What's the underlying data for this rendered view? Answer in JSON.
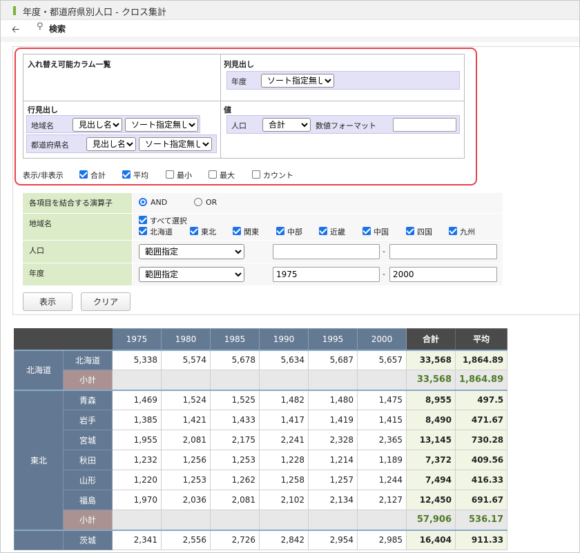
{
  "window": {
    "title": "年度・都道府県別人口 - クロス集計"
  },
  "toolbar": {
    "search_label": "検索"
  },
  "config": {
    "columns_list_title": "入れ替え可能カラム一覧",
    "col_header_title": "列見出し",
    "col_header": {
      "label": "年度",
      "sort": "ソート指定無し"
    },
    "row_header_title": "行見出し",
    "row_headers": [
      {
        "label": "地域名",
        "display": "見出し名",
        "sort": "ソート指定無し"
      },
      {
        "label": "都道府県名",
        "display": "見出し名",
        "sort": "ソート指定無し"
      }
    ],
    "value_title": "値",
    "value": {
      "label": "人口",
      "agg": "合計",
      "format_label": "数値フォーマット",
      "format_value": ""
    },
    "show_hide": {
      "label": "表示/非表示",
      "options": [
        {
          "label": "合計",
          "checked": true
        },
        {
          "label": "平均",
          "checked": true
        },
        {
          "label": "最小",
          "checked": false
        },
        {
          "label": "最大",
          "checked": false
        },
        {
          "label": "カウント",
          "checked": false
        }
      ]
    }
  },
  "conditions": {
    "operator_label": "各項目を結合する演算子",
    "operator_and": "AND",
    "operator_or": "OR",
    "region_label": "地域名",
    "select_all": "すべて選択",
    "regions": [
      "北海道",
      "東北",
      "関東",
      "中部",
      "近畿",
      "中国",
      "四国",
      "九州"
    ],
    "population_label": "人口",
    "population_mode": "範囲指定",
    "population_from": "",
    "population_to": "",
    "year_label": "年度",
    "year_mode": "範囲指定",
    "year_from": "1975",
    "year_to": "2000",
    "range_sep": "-"
  },
  "buttons": {
    "show": "表示",
    "clear": "クリア"
  },
  "grid": {
    "years": [
      "1975",
      "1980",
      "1985",
      "1990",
      "1995",
      "2000"
    ],
    "total_header": "合計",
    "avg_header": "平均",
    "subtotal_label": "小計",
    "groups": [
      {
        "region": "北海道",
        "rows": [
          {
            "pref": "北海道",
            "values": [
              "5,338",
              "5,574",
              "5,678",
              "5,634",
              "5,687",
              "5,657"
            ],
            "total": "33,568",
            "avg": "1,864.89"
          }
        ],
        "subtotal": {
          "total": "33,568",
          "avg": "1,864.89"
        }
      },
      {
        "region": "東北",
        "rows": [
          {
            "pref": "青森",
            "values": [
              "1,469",
              "1,524",
              "1,525",
              "1,482",
              "1,480",
              "1,475"
            ],
            "total": "8,955",
            "avg": "497.5"
          },
          {
            "pref": "岩手",
            "values": [
              "1,385",
              "1,421",
              "1,433",
              "1,417",
              "1,419",
              "1,415"
            ],
            "total": "8,490",
            "avg": "471.67"
          },
          {
            "pref": "宮城",
            "values": [
              "1,955",
              "2,081",
              "2,175",
              "2,241",
              "2,328",
              "2,365"
            ],
            "total": "13,145",
            "avg": "730.28"
          },
          {
            "pref": "秋田",
            "values": [
              "1,232",
              "1,256",
              "1,253",
              "1,228",
              "1,214",
              "1,189"
            ],
            "total": "7,372",
            "avg": "409.56"
          },
          {
            "pref": "山形",
            "values": [
              "1,220",
              "1,253",
              "1,262",
              "1,258",
              "1,257",
              "1,244"
            ],
            "total": "7,494",
            "avg": "416.33"
          },
          {
            "pref": "福島",
            "values": [
              "1,970",
              "2,036",
              "2,081",
              "2,102",
              "2,134",
              "2,127"
            ],
            "total": "12,450",
            "avg": "691.67"
          }
        ],
        "subtotal": {
          "total": "57,906",
          "avg": "536.17"
        }
      },
      {
        "region": "",
        "rows": [
          {
            "pref": "茨城",
            "values": [
              "2,341",
              "2,556",
              "2,726",
              "2,842",
              "2,954",
              "2,985"
            ],
            "total": "16,404",
            "avg": "911.33"
          }
        ],
        "subtotal": null
      }
    ]
  },
  "colors": {
    "accent": "#1a73e8",
    "highlight_border": "#e8424a",
    "header_bg": "#647a93"
  }
}
